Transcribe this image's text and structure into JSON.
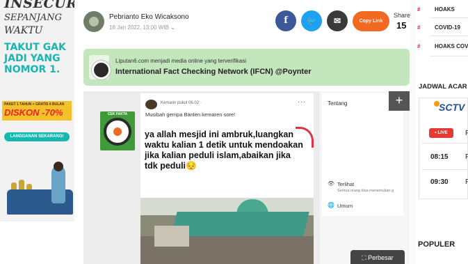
{
  "ad": {
    "line1": "INSECURE",
    "line2": "SEPANJANG",
    "line3": "WAKTU",
    "slogan": "TAKUT GAK JADI YANG NOMOR 1.",
    "promo_small": "PAKET 1 TAHUN + GRATIS 6 BULAN",
    "discount": "DISKON -70%",
    "cta": "LANGGANAN SEKARANG!"
  },
  "byline": {
    "author": "Pebrianto Eko Wicaksono",
    "date": "16 Jan 2022, 13:00 WIB",
    "chevron": "⌄"
  },
  "share": {
    "facebook_glyph": "f",
    "twitter_glyph": "🐦",
    "email_glyph": "✉",
    "copy_label": "Copy Link",
    "share_label": "Share",
    "share_count": "15"
  },
  "ifcn": {
    "line1": "Liputan6.com menjadi media online yang terverifikasi",
    "line2": "International Fact Checking Network (IFCN) @Poynter"
  },
  "post": {
    "stamp_text": "CEK FAKTA",
    "time": "Kemarin pukul 06.02 · ",
    "dots": "···",
    "caption": "Musibah gempa Banten kemaren sore!",
    "quote": "ya allah mesjid ini ambruk,luangkan waktu kalian 1 detik untuk mendoakan jika kalian peduli islam,abaikan jika tdk peduli😔"
  },
  "side_panel": {
    "plus": "+",
    "tentang": "Tentang",
    "eye_icon": "👁",
    "terlihat": "Terlihat",
    "semua": "Semua orang bisa menemukan g",
    "globe_icon": "🌐",
    "umum": "Umum"
  },
  "perbesar": "⛶ Perbesar",
  "right": {
    "tags": [
      "HOAKS",
      "COVID-19",
      "HOAKS COV"
    ],
    "hash": "#",
    "jadwal": "JADWAL ACAR",
    "channel": "SCTV",
    "live": "• LIVE",
    "schedule": [
      {
        "time": "08:15",
        "first": "F"
      },
      {
        "time": "09:30",
        "first": "F"
      }
    ],
    "live_first": "F",
    "populer": "POPULER"
  },
  "colors": {
    "accent_red": "#e02020",
    "copy_orange": "#f26a21",
    "facebook": "#3b5998",
    "twitter": "#1da1f2",
    "ifcn_green": "#c3e6bc",
    "ad_teal": "#16b7b0"
  }
}
